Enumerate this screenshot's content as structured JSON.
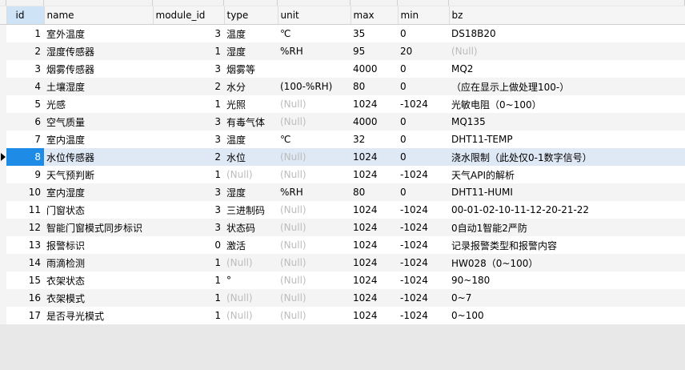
{
  "columns": [
    "id",
    "name",
    "module_id",
    "type",
    "unit",
    "max",
    "min",
    "bz"
  ],
  "null_text": "(Null)",
  "rows": [
    {
      "id": "1",
      "name": "室外温度",
      "module_id": "3",
      "type": "温度",
      "unit": "℃",
      "max": "35",
      "min": "0",
      "bz": "DS18B20"
    },
    {
      "id": "2",
      "name": "湿度传感器",
      "module_id": "1",
      "type": "湿度",
      "unit": "%RH",
      "max": "95",
      "min": "20",
      "bz": null
    },
    {
      "id": "3",
      "name": "烟雾传感器",
      "module_id": "3",
      "type": "烟雾等",
      "unit": "",
      "max": "4000",
      "min": "0",
      "bz": "MQ2"
    },
    {
      "id": "4",
      "name": "土壤湿度",
      "module_id": "2",
      "type": "水分",
      "unit": "(100-%RH)",
      "max": "80",
      "min": "0",
      "bz": "（应在显示上做处理100-）"
    },
    {
      "id": "5",
      "name": "光感",
      "module_id": "1",
      "type": "光照",
      "unit": null,
      "max": "1024",
      "min": "-1024",
      "bz": "光敏电阻（0~100）"
    },
    {
      "id": "6",
      "name": "空气质量",
      "module_id": "3",
      "type": "有毒气体",
      "unit": null,
      "max": "4000",
      "min": "0",
      "bz": "MQ135"
    },
    {
      "id": "7",
      "name": "室内温度",
      "module_id": "3",
      "type": "温度",
      "unit": "℃",
      "max": "32",
      "min": "0",
      "bz": "DHT11-TEMP"
    },
    {
      "id": "8",
      "name": "水位传感器",
      "module_id": "2",
      "type": "水位",
      "unit": null,
      "max": "1024",
      "min": "0",
      "bz": "浇水限制（此处仅0-1数字信号）"
    },
    {
      "id": "9",
      "name": "天气预判断",
      "module_id": "1",
      "type": null,
      "unit": null,
      "max": "1024",
      "min": "-1024",
      "bz": "天气API的解析"
    },
    {
      "id": "10",
      "name": "室内湿度",
      "module_id": "3",
      "type": "湿度",
      "unit": "%RH",
      "max": "80",
      "min": "0",
      "bz": "DHT11-HUMI"
    },
    {
      "id": "11",
      "name": "门窗状态",
      "module_id": "3",
      "type": "三进制码",
      "unit": null,
      "max": "1024",
      "min": "-1024",
      "bz": "00-01-02-10-11-12-20-21-22"
    },
    {
      "id": "12",
      "name": "智能门窗模式同步标识",
      "module_id": "3",
      "type": "状态码",
      "unit": null,
      "max": "1024",
      "min": "-1024",
      "bz": "0自动1智能2严防"
    },
    {
      "id": "13",
      "name": "报警标识",
      "module_id": "0",
      "type": "激活",
      "unit": null,
      "max": "1024",
      "min": "-1024",
      "bz": "记录报警类型和报警内容"
    },
    {
      "id": "14",
      "name": "雨滴检测",
      "module_id": "1",
      "type": null,
      "unit": null,
      "max": "1024",
      "min": "-1024",
      "bz": "HW028（0~100）"
    },
    {
      "id": "15",
      "name": "衣架状态",
      "module_id": "1",
      "type": "°",
      "unit": null,
      "max": "1024",
      "min": "-1024",
      "bz": "90~180"
    },
    {
      "id": "16",
      "name": "衣架模式",
      "module_id": "1",
      "type": null,
      "unit": null,
      "max": "1024",
      "min": "-1024",
      "bz": "0~7"
    },
    {
      "id": "17",
      "name": "是否寻光模式",
      "module_id": "1",
      "type": null,
      "unit": null,
      "max": "1024",
      "min": "-1024",
      "bz": "0~100"
    }
  ]
}
